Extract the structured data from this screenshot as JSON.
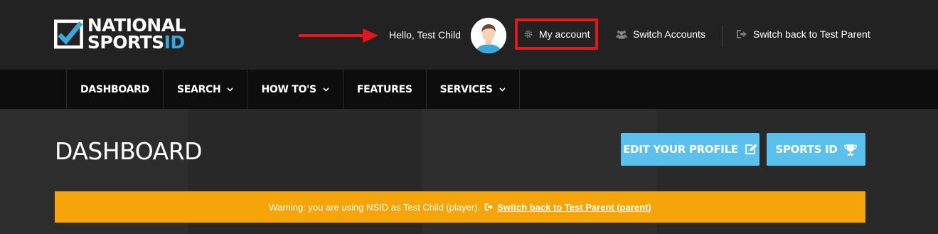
{
  "brand": {
    "line1": "NATIONAL",
    "line2": "SPORTS",
    "line2_accent": "ID",
    "accent_color": "#3aa7dd"
  },
  "header": {
    "greeting": "Hello, Test Child",
    "avatar_icon": "user-avatar-icon",
    "my_account": "My account",
    "my_account_icon": "gear-icon",
    "switch_accounts": "Switch Accounts",
    "switch_accounts_icon": "users-icon",
    "switch_back": "Switch back to Test Parent",
    "switch_back_icon": "sign-out-icon",
    "highlight_color": "#e3161b"
  },
  "nav": {
    "items": [
      {
        "label": "DASHBOARD"
      },
      {
        "label": "SEARCH"
      },
      {
        "label": "HOW TO'S"
      },
      {
        "label": "FEATURES"
      },
      {
        "label": "SERVICES"
      }
    ]
  },
  "main": {
    "title": "DASHBOARD",
    "edit_profile": "EDIT YOUR PROFILE",
    "edit_profile_icon": "edit-icon",
    "sports_id": "SPORTS ID",
    "sports_id_icon": "trophy-icon",
    "button_color": "#5bc0eb",
    "warning_text": "Warning: you are using NSID as Test Child (player).",
    "warning_link": "Switch back to Test Parent (parent)",
    "warning_color": "#f5a40a"
  }
}
